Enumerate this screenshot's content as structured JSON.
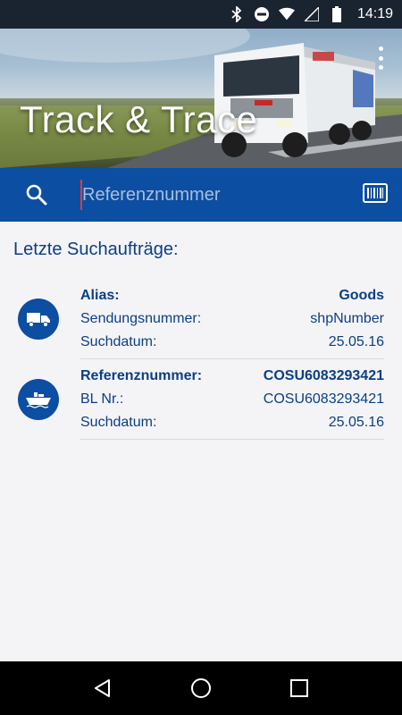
{
  "status_bar": {
    "time": "14:19",
    "icons": [
      "bluetooth-icon",
      "do-not-disturb-icon",
      "wifi-icon",
      "signal-icon",
      "battery-icon"
    ]
  },
  "header": {
    "title": "Track & Trace",
    "menu_icon": "more-vert-icon"
  },
  "search": {
    "placeholder": "Referenznummer",
    "value": "",
    "search_icon": "search-icon",
    "scan_icon": "barcode-icon"
  },
  "recent": {
    "title": "Letzte Suchaufträge:",
    "entries": [
      {
        "icon": "truck-icon",
        "rows": [
          {
            "label": "Alias:",
            "value": "Goods"
          },
          {
            "label": "Sendungsnummer:",
            "value": "shpNumber"
          },
          {
            "label": "Suchdatum:",
            "value": "25.05.16"
          }
        ]
      },
      {
        "icon": "ship-icon",
        "rows": [
          {
            "label": "Referenznummer:",
            "value": "COSU6083293421"
          },
          {
            "label": "BL Nr.:",
            "value": "COSU6083293421"
          },
          {
            "label": "Suchdatum:",
            "value": "25.05.16"
          }
        ]
      }
    ]
  },
  "nav": {
    "back": "back-icon",
    "home": "home-icon",
    "recents": "recents-icon"
  },
  "colors": {
    "primary": "#0b4ea2",
    "text": "#0b3f84",
    "cursor": "#e53935"
  }
}
